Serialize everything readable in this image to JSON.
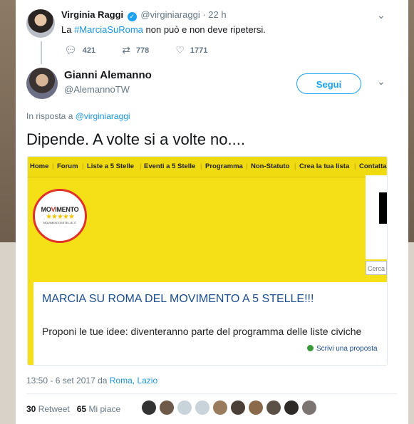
{
  "parent_tweet": {
    "name": "Virginia Raggi",
    "handle": "@virginiaraggi",
    "time": "· 22 h",
    "text_before": "La ",
    "hashtag": "#MarciaSuRoma",
    "text_after": " non può e non deve ripetersi.",
    "replies": "421",
    "retweets": "778",
    "likes": "1771"
  },
  "reply_tweet": {
    "name": "Gianni Alemanno",
    "handle": "@AlemannoTW",
    "follow_label": "Segui",
    "in_reply_prefix": "In risposta a ",
    "in_reply_handle": "@virginiaraggi",
    "text": "Dipende. A volte si a volte no....",
    "timestamp_prefix": "13:50 - 6 set 2017 da ",
    "location": "Roma, Lazio",
    "retweet_count": "30",
    "retweet_label": "Retweet",
    "like_count": "65",
    "like_label": "Mi piace"
  },
  "embedded_image": {
    "nav_items": [
      "Home",
      "Forum",
      "Liste a 5 Stelle",
      "Eventi a 5 Stelle",
      "Programma",
      "Non-Statuto",
      "Crea la tua lista",
      "Contatta"
    ],
    "logo_text_a": "MO",
    "logo_text_v": "V",
    "logo_text_b": "IMENTO",
    "logo_stars": "★★★★★",
    "logo_url": "MOVIMENTO5STELLE.IT",
    "search_placeholder": "Cerca",
    "title": "MARCIA SU ROMA DEL MOVIMENTO A 5 STELLE!!!",
    "subtitle": "Proponi le tue idee: diventeranno parte del programma delle liste civiche",
    "propose_link": "Scrivi una proposta"
  },
  "colors": {
    "accent": "#1da1f2",
    "m5s_yellow": "#f5df16",
    "m5s_red": "#e03228"
  }
}
